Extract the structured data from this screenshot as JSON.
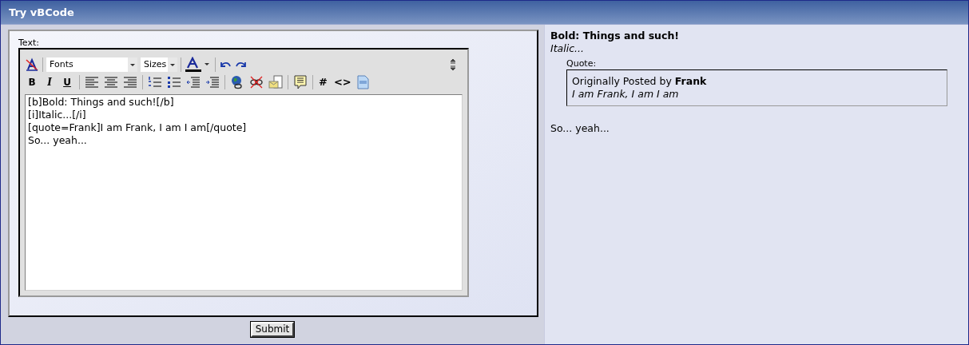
{
  "window": {
    "title": "Try vBCode"
  },
  "editor": {
    "label": "Text:",
    "font_select": "Fonts",
    "size_select": "Sizes",
    "format_buttons": [
      "B",
      "I",
      "U"
    ],
    "code_buttons": [
      "#",
      "<>"
    ],
    "lines": [
      "[b]Bold: Things and such![/b]",
      "[i]Italic...[/i]",
      "[quote=Frank]I am Frank, I am I am[/quote]",
      "So... yeah..."
    ]
  },
  "submit": "Submit",
  "preview": {
    "bold": "Bold: Things and such!",
    "italic": "Italic...",
    "quote_label": "Quote:",
    "quote_author": "Originally Posted by **Frank**",
    "quote_text": "I am Frank, I am I am",
    "tail": "So... yeah..."
  }
}
